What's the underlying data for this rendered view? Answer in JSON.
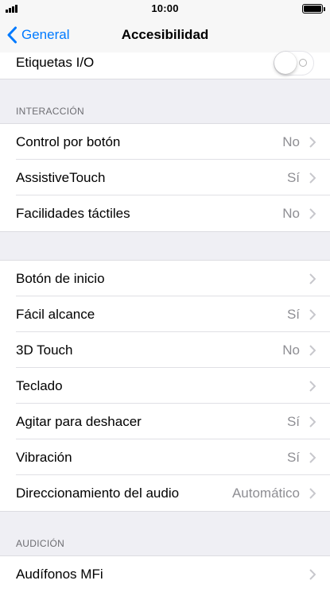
{
  "status_bar": {
    "time": "10:00"
  },
  "nav": {
    "back_label": "General",
    "title": "Accesibilidad"
  },
  "top_row": {
    "label": "Etiquetas I/O",
    "toggle_on": false
  },
  "section_interaction": {
    "header": "INTERACCIÓN",
    "items": [
      {
        "label": "Control por botón",
        "value": "No"
      },
      {
        "label": "AssistiveTouch",
        "value": "Sí"
      },
      {
        "label": "Facilidades táctiles",
        "value": "No"
      }
    ]
  },
  "section_general": {
    "items": [
      {
        "label": "Botón de inicio",
        "value": ""
      },
      {
        "label": "Fácil alcance",
        "value": "Sí"
      },
      {
        "label": "3D Touch",
        "value": "No"
      },
      {
        "label": "Teclado",
        "value": ""
      },
      {
        "label": "Agitar para deshacer",
        "value": "Sí"
      },
      {
        "label": "Vibración",
        "value": "Sí"
      },
      {
        "label": "Direccionamiento del audio",
        "value": "Automático"
      }
    ]
  },
  "section_hearing": {
    "header": "AUDICIÓN",
    "items": [
      {
        "label": "Audífonos MFi",
        "value": ""
      }
    ]
  },
  "colors": {
    "accent": "#007aff",
    "background": "#efeff4",
    "secondary_text": "#8e8e93",
    "chevron": "#c7c7cc"
  },
  "icons": {
    "back": "chevron-left-icon",
    "disclosure": "chevron-right-icon"
  }
}
